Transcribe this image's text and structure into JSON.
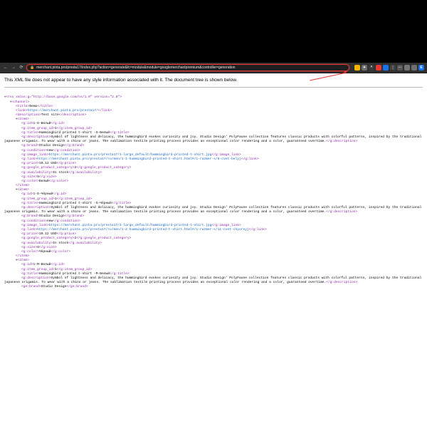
{
  "browser": {
    "url": "merchant.pinta.pro/presta17/index.php?action=generate&fc=module&module=googlemerchantpremium&controller=generation",
    "lock_label": "🔒",
    "nav": {
      "back": "←",
      "fwd": "→",
      "reload": "⟳"
    },
    "extensions": [
      {
        "bg": "#f4b400",
        "txt": ""
      },
      {
        "bg": "#6d6d6d",
        "txt": "✦"
      },
      {
        "bg": "#3a3a3a",
        "txt": "^"
      },
      {
        "bg": "#e53935",
        "txt": ""
      },
      {
        "bg": "#1a73e8",
        "txt": ""
      },
      {
        "bg": "#424242",
        "txt": "⋮"
      },
      {
        "bg": "#555555",
        "txt": "⋯"
      },
      {
        "bg": "#757575",
        "txt": ""
      },
      {
        "bg": "#6e6e6e",
        "txt": ""
      },
      {
        "bg": "#1a73e8",
        "txt": "E"
      }
    ]
  },
  "notice": "This XML file does not appear to have any style information associated with it. The document tree is shown below.",
  "xml": {
    "root": "<rss xmlns:g=\"http://base.google.com/ns/1.0\" version=\"2.0\">",
    "channel_open": "<channel>",
    "title": {
      "open": "<title>",
      "text": "Demo",
      "close": "</title>"
    },
    "link": {
      "open": "<link>",
      "text": "https://merchant.pinta.pro/presta17/",
      "close": "</link>"
    },
    "desc": {
      "open": "<description>",
      "text": "Test site",
      "close": "</description>"
    },
    "items": [
      {
        "id": {
          "open": "<g:id>",
          "text": "1-S-Белый",
          "close": "</g:id>"
        },
        "igid": {
          "open": "<g:item_group_id>",
          "text": "1",
          "close": "</g:item_group_id>"
        },
        "tt": {
          "open": "<g:title>",
          "text": "Hummingbird printed t-shirt -S-Белый",
          "close": "</g:title>"
        },
        "dsc": {
          "open": "<g:description>",
          "text": "Symbol of lightness and delicacy, the hummingbird evokes curiosity and joy. Studio Design' PolyFaune collection features classic products with colorful patterns, inspired by the traditional japanese origamis. To wear with a chino or jeans. The sublimation textile printing process provides an exceptional color rendering and a color, guaranteed overtime.",
          "close": "</g:description>"
        },
        "brand": {
          "open": "<g:brand>",
          "text": "Studio Design",
          "close": "</g:brand>"
        },
        "cond": {
          "open": "<g:condition>",
          "text": "new",
          "close": "</g:condition>"
        },
        "img": {
          "open": "<g:image_link>",
          "text": "https://merchant.pinta.pro/presta17/1-large_default/hummingbird-printed-t-shirt.jpg",
          "close": "</g:image_link>"
        },
        "lnk": {
          "open": "<g:link>",
          "text": "https://merchant.pinta.pro/presta17/ru/men/1-1-hummingbird-printed-t-shirt.html#/1-razmer-s/8-cvet-belyj",
          "close": "</g:link>"
        },
        "price": {
          "open": "<g:price>",
          "text": "19.12 USD",
          "close": "</g:price>"
        },
        "gpc": {
          "open": "<g:google_product_category>",
          "text": "2",
          "close": "</g:google_product_category>"
        },
        "avail": {
          "open": "<g:availability>",
          "text": "In stock",
          "close": "</g:availability>"
        },
        "size": {
          "open": "<g:size>",
          "text": "S",
          "close": "</g:size>"
        },
        "color": {
          "open": "<g:color>",
          "text": "Белый",
          "close": "</g:color>"
        }
      },
      {
        "id": {
          "open": "<g:id>",
          "text": "1-S-Чёрный",
          "close": "</g:id>"
        },
        "igid": {
          "open": "<g:item_group_id>",
          "text": "1",
          "close": "</g:item_group_id>"
        },
        "tt": {
          "open": "<g:title>",
          "text": "Hummingbird printed t-shirt -S-Чёрный",
          "close": "</g:title>"
        },
        "dsc": {
          "open": "<g:description>",
          "text": "Symbol of lightness and delicacy, the hummingbird evokes curiosity and joy. Studio Design' PolyFaune collection features classic products with colorful patterns, inspired by the traditional japanese origamis. To wear with a chino or jeans. The sublimation textile printing process provides an exceptional color rendering and a color, guaranteed overtime.",
          "close": "</g:description>"
        },
        "brand": {
          "open": "<g:brand>",
          "text": "Studio Design",
          "close": "</g:brand>"
        },
        "cond": {
          "open": "<g:condition>",
          "text": "new",
          "close": "</g:condition>"
        },
        "img": {
          "open": "<g:image_link>",
          "text": "https://merchant.pinta.pro/presta17/1-large_default/hummingbird-printed-t-shirt.jpg",
          "close": "</g:image_link>"
        },
        "lnk": {
          "open": "<g:link>",
          "text": "https://merchant.pinta.pro/presta17/ru/men/1-2-hummingbird-printed-t-shirt.html#/1-razmer-s/11-cvet-chyornyj",
          "close": "</g:link>"
        },
        "price": {
          "open": "<g:price>",
          "text": "19.12 USD",
          "close": "</g:price>"
        },
        "gpc": {
          "open": "<g:google_product_category>",
          "text": "2",
          "close": "</g:google_product_category>"
        },
        "avail": {
          "open": "<g:availability>",
          "text": "In stock",
          "close": "</g:availability>"
        },
        "size": {
          "open": "<g:size>",
          "text": "S",
          "close": "</g:size>"
        },
        "color": {
          "open": "<g:color>",
          "text": "Чёрный",
          "close": "</g:color>"
        }
      },
      {
        "id": {
          "open": "<g:id>",
          "text": "1-M-Белый",
          "close": "</g:id>"
        },
        "igid": {
          "open": "<g:item_group_id>",
          "text": "1",
          "close": "</g:item_group_id>"
        },
        "tt": {
          "open": "<g:title>",
          "text": "Hummingbird printed t-shirt -M-Белый",
          "close": "</g:title>"
        },
        "dsc": {
          "open": "<g:description>",
          "text": "Symbol of lightness and delicacy, the hummingbird evokes curiosity and joy. Studio Design' PolyFaune collection features classic products with colorful patterns, inspired by the traditional japanese origamis. To wear with a chino or jeans. The sublimation textile printing process provides an exceptional color rendering and a color, guaranteed overtime.",
          "close": "</g:description>"
        },
        "brand": {
          "open": "<ge:brand>",
          "text": "Studio Design",
          "close": "</ge:brand>"
        }
      }
    ]
  }
}
